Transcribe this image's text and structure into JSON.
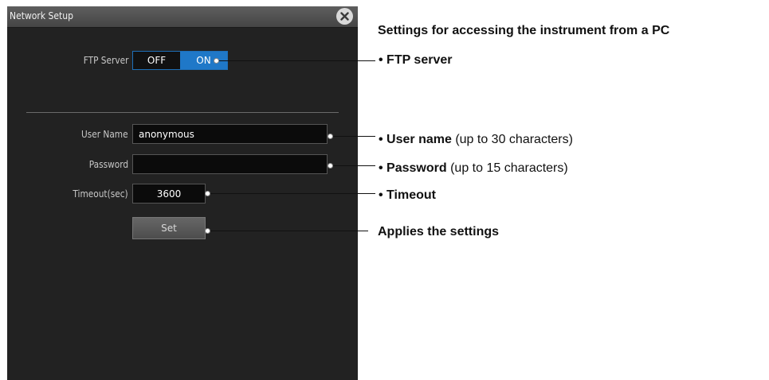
{
  "window": {
    "title": "Network Setup",
    "close_icon": "close-icon"
  },
  "ftp": {
    "label": "FTP Server",
    "off_label": "OFF",
    "on_label": "ON",
    "selected": "ON"
  },
  "user": {
    "label": "User Name",
    "value": "anonymous"
  },
  "password": {
    "label": "Password",
    "value": ""
  },
  "timeout": {
    "label": "Timeout(sec)",
    "value": "3600"
  },
  "set_button": {
    "label": "Set"
  },
  "annotations": {
    "heading": "Settings for accessing the instrument from a PC",
    "ftp": {
      "bold": "• FTP server",
      "rest": ""
    },
    "user": {
      "bold": "• User name",
      "rest": " (up to 30 characters)"
    },
    "password": {
      "bold": "• Password",
      "rest": " (up to 15 characters)"
    },
    "timeout": {
      "bold": "• Timeout",
      "rest": ""
    },
    "apply": {
      "bold": "Applies the settings",
      "rest": ""
    }
  },
  "colors": {
    "panel_bg": "#222222",
    "accent_on": "#1f78c8"
  }
}
